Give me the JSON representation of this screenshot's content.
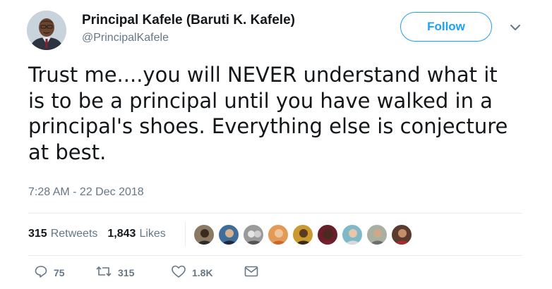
{
  "author": {
    "name": "Principal Kafele (Baruti K. Kafele)",
    "handle": "@PrincipalKafele",
    "avatar_icon": "profile-photo"
  },
  "follow_button": {
    "label": "Follow",
    "color": "#1da1f2"
  },
  "menu_icon": "chevron-down-icon",
  "tweet": {
    "lines": [
      "Trust me....you will NEVER understand what it",
      "is to be a principal until you have walked in a",
      "principal's shoes. Everything else is conjecture",
      "at best."
    ],
    "timestamp": "7:28 AM - 22 Dec 2018"
  },
  "stats": {
    "retweets_count": "315",
    "retweets_label": "Retweets",
    "likes_count": "1,843",
    "likes_label": "Likes"
  },
  "likers": [
    "liker-1",
    "liker-2",
    "liker-3",
    "liker-4",
    "liker-5",
    "liker-6",
    "liker-7",
    "liker-8",
    "liker-9"
  ],
  "actions": {
    "reply_count": "75",
    "retweet_count": "315",
    "like_count": "1.8K",
    "reply_icon": "reply-icon",
    "retweet_icon": "retweet-icon",
    "like_icon": "heart-icon",
    "dm_icon": "envelope-icon"
  },
  "colors": {
    "text": "#14171a",
    "muted": "#657786",
    "divider": "#e6ecf0",
    "accent": "#1da1f2"
  }
}
